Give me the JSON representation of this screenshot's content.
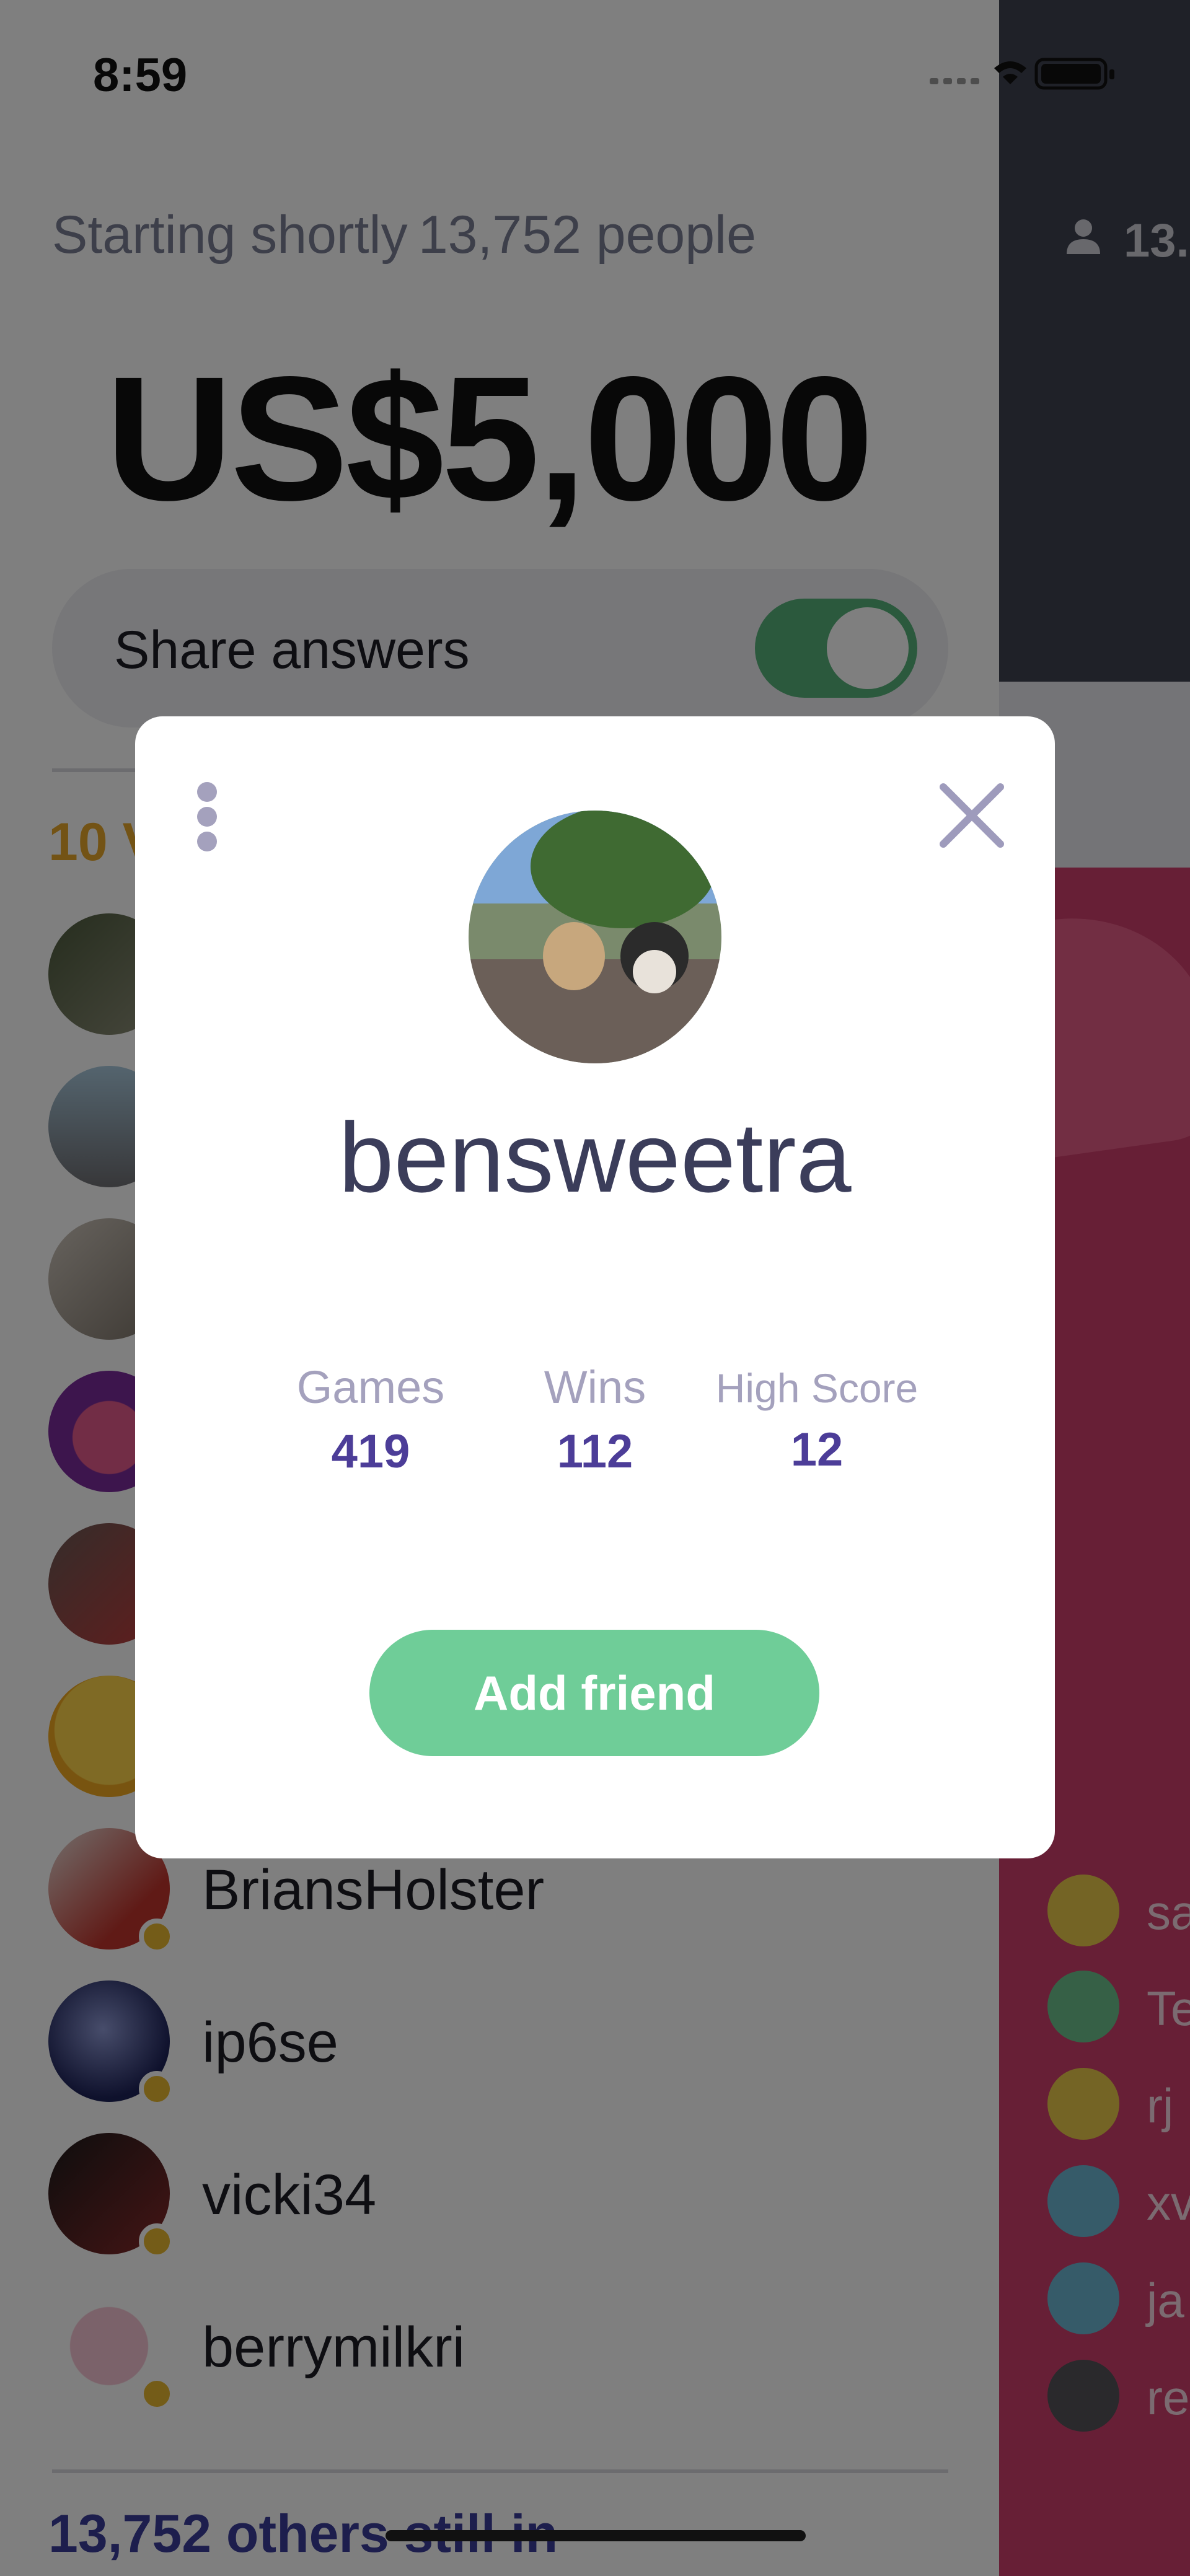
{
  "status_bar": {
    "time": "8:59"
  },
  "game": {
    "status": "Starting shortly",
    "players": "13,752 people",
    "prize": "US$5,000",
    "share_label": "Share answers",
    "share_enabled": true,
    "winners_heading": "10 V",
    "others_still_in": "13,752 others still in"
  },
  "side_panel": {
    "player_count": "13.",
    "chat_names": [
      "sa",
      "Te",
      "rj",
      "xv",
      "ja",
      "re"
    ]
  },
  "players_list": [
    {
      "username": ""
    },
    {
      "username": ""
    },
    {
      "username": ""
    },
    {
      "username": ""
    },
    {
      "username": ""
    },
    {
      "username": ""
    },
    {
      "username": "BriansHolster"
    },
    {
      "username": "ip6se"
    },
    {
      "username": "vicki34"
    },
    {
      "username": "berrymilkri"
    }
  ],
  "profile_modal": {
    "username": "bensweetra",
    "stats": [
      {
        "label": "Games",
        "value": "419"
      },
      {
        "label": "Wins",
        "value": "112"
      },
      {
        "label": "High Score",
        "value": "12"
      }
    ],
    "add_friend_label": "Add friend"
  },
  "colors": {
    "accent_green": "#6fcd98",
    "stat_value": "#4c3d98",
    "winner_gold": "#e6a72a",
    "side_pink": "#cf3f6c"
  }
}
